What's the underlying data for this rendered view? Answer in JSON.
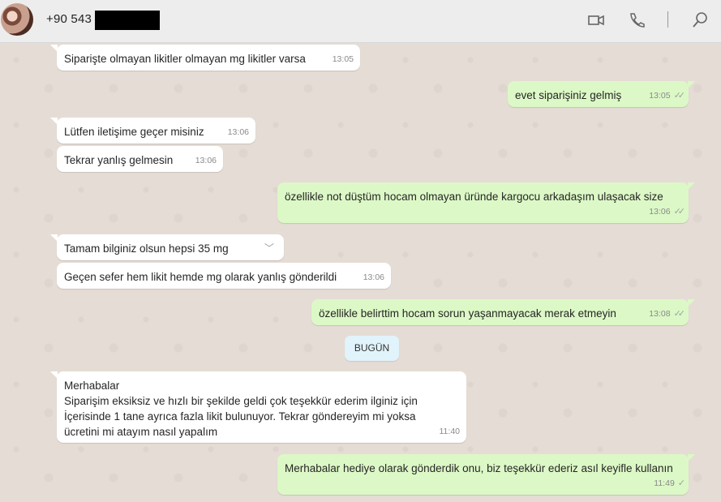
{
  "header": {
    "contact_name": "+90 543",
    "icons": [
      "video-call-icon",
      "voice-call-icon",
      "search-icon"
    ]
  },
  "messages": [
    {
      "dir": "in",
      "text": "Siparişte olmayan likitler olmayan mg likitler varsa",
      "time": "13:05"
    },
    {
      "dir": "out",
      "text": "evet siparişiniz gelmiş",
      "time": "13:05",
      "read": true
    },
    {
      "dir": "in",
      "text": "Lütfen iletişime geçer misiniz",
      "time": "13:06"
    },
    {
      "dir": "in",
      "text": "Tekrar yanlış gelmesin",
      "time": "13:06"
    },
    {
      "dir": "out",
      "text": "özellikle not düştüm hocam olmayan üründe kargocu arkadaşım ulaşacak size",
      "time": "13:06",
      "read": true
    },
    {
      "dir": "in",
      "text": "Tamam bilginiz olsun hepsi 35 mg",
      "time": ""
    },
    {
      "dir": "in",
      "text": "Geçen sefer hem likit hemde mg olarak yanlış gönderildi",
      "time": "13:06"
    },
    {
      "dir": "out",
      "text": "özellikle belirttim hocam sorun yaşanmayacak merak etmeyin",
      "time": "13:08",
      "read": true
    },
    {
      "dir": "in",
      "text": "Merhabalar\nSiparişim eksiksiz ve hızlı bir şekilde geldi çok teşekkür ederim ilginiz için\nİçerisinde 1 tane ayrıca fazla likit bulunuyor. Tekrar göndereyim mi yoksa\nücretini mi atayım nasıl yapalım",
      "time": "11:40"
    },
    {
      "dir": "out",
      "text": "Merhabalar hediye olarak gönderdik onu, biz teşekkür ederiz asıl keyifle kullanın",
      "time": "11:49",
      "read": false
    }
  ],
  "day_separator": "BUGÜN",
  "colors": {
    "incoming": "#ffffff",
    "outgoing": "#dcf8c6",
    "background": "#e5ddd5",
    "header": "#ededed",
    "day_pill": "#e1f3fb"
  }
}
